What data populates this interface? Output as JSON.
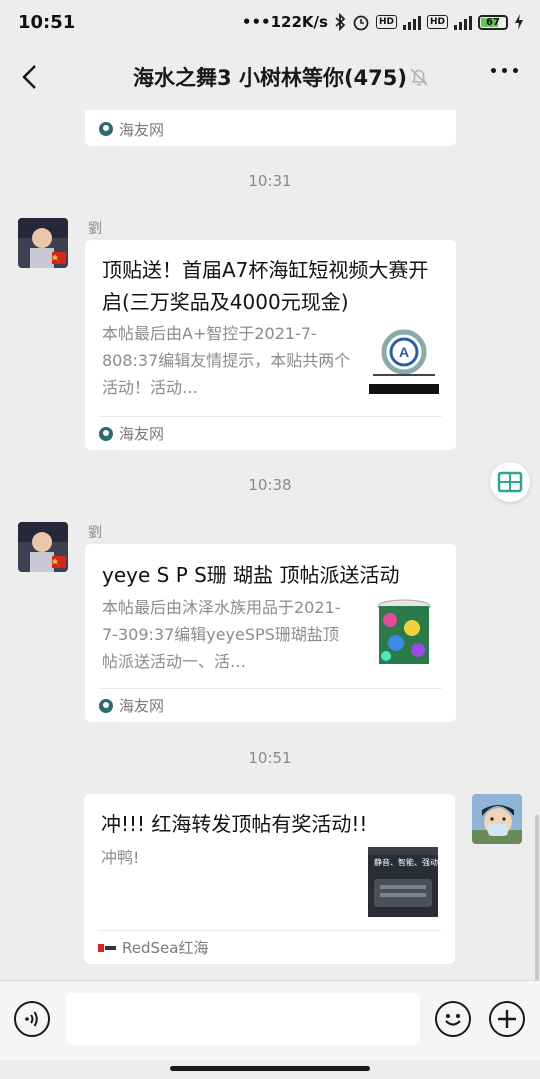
{
  "status": {
    "time": "10:51",
    "net_speed": "•••122K/s",
    "hd1": "HD",
    "hd2": "HD",
    "battery": "67"
  },
  "header": {
    "title": "海水之舞3 小树林等你(475)"
  },
  "messages": {
    "prev_card_source": "海友网",
    "time1": "10:31",
    "msg1": {
      "sender": "劉",
      "title": "顶贴送！首届A7杯海缸短视频大赛开启(三万奖品及4000元现金)",
      "desc": "本帖最后由A+智控于2021-7-808:37编辑友情提示，本贴共两个活动！活动…",
      "source": "海友网"
    },
    "time2": "10:38",
    "msg2": {
      "sender": "劉",
      "title": "yeye S P S珊 瑚盐 顶帖派送活动",
      "desc": "本帖最后由沐泽水族用品于2021-7-309:37编辑yeyeSPS珊瑚盐顶帖派送活动一、活…",
      "source": "海友网"
    },
    "time3": "10:51",
    "msg3": {
      "title": "冲!!! 红海转发顶帖有奖活动!!",
      "desc": "冲鸭!",
      "thumb_text": "静音、智能、强动",
      "source": "RedSea红海"
    }
  },
  "input": {
    "placeholder": ""
  },
  "icons": [
    "back-arrow-icon",
    "mute-bell-icon",
    "more-icon",
    "voice-icon",
    "emoji-icon",
    "plus-icon",
    "translate-float-icon"
  ]
}
